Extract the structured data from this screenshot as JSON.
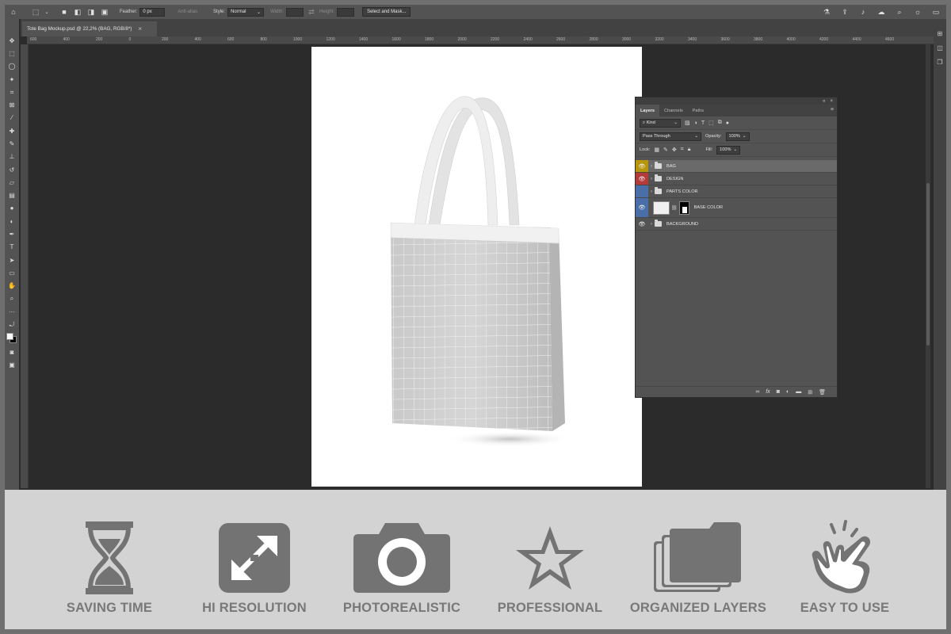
{
  "options_bar": {
    "feather_label": "Feather:",
    "feather_value": "0 px",
    "anti_alias_label": "Anti-alias",
    "style_label": "Style:",
    "style_value": "Normal",
    "width_label": "Width:",
    "height_label": "Height:",
    "select_mask_button": "Select and Mask..."
  },
  "document_tab": {
    "title": "Tote Bag Mockup.psd @ 22,2% (BAG, RGB/8*)",
    "close": "×"
  },
  "ruler_ticks": [
    "600",
    "400",
    "200",
    "0",
    "200",
    "400",
    "600",
    "800",
    "1000",
    "1200",
    "1400",
    "1600",
    "1800",
    "2000",
    "2200",
    "2400",
    "2600",
    "2800",
    "3000",
    "3200",
    "3400",
    "3600",
    "3800",
    "4000",
    "4200",
    "4400",
    "4600"
  ],
  "layers_panel": {
    "tabs": [
      "Layers",
      "Channels",
      "Paths"
    ],
    "filter_kind": "Kind",
    "blend_mode": "Pass Through",
    "opacity_label": "Opacity:",
    "opacity_value": "100%",
    "lock_label": "Lock:",
    "fill_label": "Fill:",
    "fill_value": "100%",
    "layers": [
      {
        "name": "BAG",
        "color": "#b8960c",
        "visible": true,
        "type": "group"
      },
      {
        "name": "DESIGN",
        "color": "#b53a3a",
        "visible": true,
        "type": "group"
      },
      {
        "name": "PARTS COLOR",
        "color": "#4a6ea8",
        "visible": false,
        "type": "group"
      },
      {
        "name": "BASE COLOR",
        "color": "#4a6ea8",
        "visible": true,
        "type": "layer"
      },
      {
        "name": "BACKGROUND",
        "color": "",
        "visible": true,
        "type": "group"
      }
    ]
  },
  "features": [
    {
      "label": "SAVING TIME",
      "icon": "hourglass-icon"
    },
    {
      "label": "HI RESOLUTION",
      "icon": "expand-arrows-icon"
    },
    {
      "label": "PHOTOREALISTIC",
      "icon": "camera-icon"
    },
    {
      "label": "PROFESSIONAL",
      "icon": "star-icon"
    },
    {
      "label": "ORGANIZED LAYERS",
      "icon": "stacked-folders-icon"
    },
    {
      "label": "EASY TO USE",
      "icon": "hand-pointer-icon"
    }
  ],
  "colors": {
    "feature_icon": "#737373",
    "feature_bg": "#d3d3d3",
    "workspace_bg": "#2b2b2b"
  }
}
